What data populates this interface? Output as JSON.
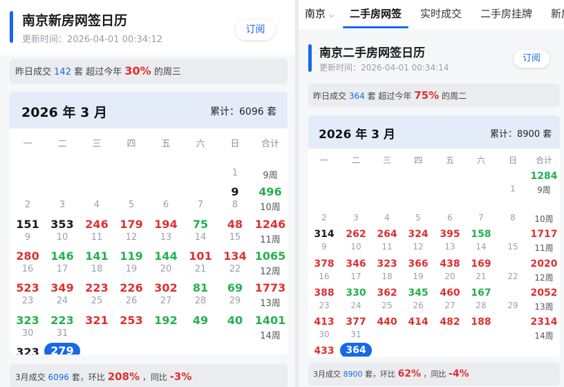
{
  "left": {
    "title": "南京新房网签日历",
    "update_time": "更新时间：2026-04-01 00:34:12",
    "subscribe_label": "订阅",
    "info": {
      "pre": "昨日成交",
      "num": "142",
      "mid": "套 超过今年",
      "pct": "30%",
      "post": "的周三"
    },
    "month": "2026 年 3 月",
    "cumulative": "累计：6096 套",
    "weekday_headers": [
      "一",
      "二",
      "三",
      "四",
      "五",
      "六",
      "日",
      "合计"
    ],
    "weeks": [
      {
        "cells": [
          null,
          null,
          null,
          null,
          null,
          null,
          {
            "day": "1"
          }
        ],
        "sum": null,
        "week": "9周"
      },
      {
        "cells": [
          {
            "day": "2"
          },
          {
            "day": "3"
          },
          {
            "day": "4"
          },
          {
            "day": "5"
          },
          {
            "day": "6"
          },
          {
            "day": "7"
          },
          {
            "val": "9",
            "color": "black",
            "day": "8"
          }
        ],
        "sum": {
          "val": "496",
          "color": "green"
        },
        "week": "10周"
      },
      {
        "cells": [
          {
            "val": "151",
            "color": "black",
            "day": "9"
          },
          {
            "val": "353",
            "color": "black",
            "day": "10"
          },
          {
            "val": "246",
            "color": "red",
            "day": "11"
          },
          {
            "val": "179",
            "color": "red",
            "day": "12"
          },
          {
            "val": "194",
            "color": "red",
            "day": "13"
          },
          {
            "val": "75",
            "color": "green",
            "day": "14"
          },
          {
            "val": "48",
            "color": "red",
            "day": "15"
          }
        ],
        "sum": {
          "val": "1246",
          "color": "red"
        },
        "week": "11周"
      },
      {
        "cells": [
          {
            "val": "280",
            "color": "red",
            "day": "16"
          },
          {
            "val": "146",
            "color": "green",
            "day": "17"
          },
          {
            "val": "141",
            "color": "green",
            "day": "18"
          },
          {
            "val": "119",
            "color": "green",
            "day": "19"
          },
          {
            "val": "144",
            "color": "green",
            "day": "20"
          },
          {
            "val": "101",
            "color": "red",
            "day": "21"
          },
          {
            "val": "134",
            "color": "red",
            "day": "22"
          }
        ],
        "sum": {
          "val": "1065",
          "color": "green"
        },
        "week": "12周"
      },
      {
        "cells": [
          {
            "val": "523",
            "color": "red",
            "day": "23"
          },
          {
            "val": "349",
            "color": "red",
            "day": "24"
          },
          {
            "val": "223",
            "color": "red",
            "day": "25"
          },
          {
            "val": "226",
            "color": "red",
            "day": "26"
          },
          {
            "val": "302",
            "color": "red",
            "day": "27"
          },
          {
            "val": "81",
            "color": "green",
            "day": "28"
          },
          {
            "val": "69",
            "color": "green",
            "day": "29"
          }
        ],
        "sum": {
          "val": "1773",
          "color": "red"
        },
        "week": "13周"
      },
      {
        "cells": [
          {
            "val": "323",
            "color": "green",
            "day": "30"
          },
          {
            "val": "223",
            "color": "green",
            "day": "31"
          },
          {
            "val": "321",
            "color": "red"
          },
          {
            "val": "253",
            "color": "red"
          },
          {
            "val": "192",
            "color": "green"
          },
          {
            "val": "49",
            "color": "green"
          },
          {
            "val": "40",
            "color": "green"
          }
        ],
        "sum": {
          "val": "1401",
          "color": "green"
        },
        "week": "14周"
      },
      {
        "cells": [
          {
            "val": "323",
            "color": "black"
          },
          {
            "today": "279"
          },
          null,
          null,
          null,
          null,
          null
        ],
        "sum": null,
        "week": null
      }
    ],
    "bottom": {
      "pre": "3月成交",
      "num": "6096",
      "mid1": "套，环比",
      "huanbi": "208%",
      "mid2": "，同比",
      "tongbi": "-3%"
    }
  },
  "right": {
    "city": "南京",
    "tabs": [
      "二手房网签",
      "实时成交",
      "二手房挂牌",
      "新房"
    ],
    "title": "南京二手房网签日历",
    "update_time": "更新时间：2026-04-01 00:34:14",
    "subscribe_label": "订阅",
    "info": {
      "pre": "昨日成交",
      "num": "364",
      "mid": "套 超过今年",
      "pct": "75%",
      "post": "的周二"
    },
    "month": "2026 年 3 月",
    "cumulative": "累计：8900 套",
    "weekday_headers": [
      "一",
      "二",
      "三",
      "四",
      "五",
      "六",
      "日",
      "合计"
    ],
    "weeks": [
      {
        "cells": [
          null,
          null,
          null,
          null,
          null,
          null,
          {
            "day": "1"
          }
        ],
        "sum": {
          "val": "1284",
          "color": "green"
        },
        "week": "9周"
      },
      {
        "cells": [
          {
            "day": "2"
          },
          {
            "day": "3"
          },
          {
            "day": "4"
          },
          {
            "day": "5"
          },
          {
            "day": "6"
          },
          {
            "day": "7"
          },
          {
            "day": "8"
          }
        ],
        "sum": null,
        "week": "10周"
      },
      {
        "cells": [
          {
            "val": "314",
            "color": "black",
            "day": "9"
          },
          {
            "val": "262",
            "color": "red",
            "day": "10"
          },
          {
            "val": "264",
            "color": "red",
            "day": "11"
          },
          {
            "val": "324",
            "color": "red",
            "day": "12"
          },
          {
            "val": "395",
            "color": "red",
            "day": "13"
          },
          {
            "val": "158",
            "color": "green",
            "day": "14"
          },
          {
            "day": "15"
          }
        ],
        "sum": {
          "val": "1717",
          "color": "red"
        },
        "week": "11周"
      },
      {
        "cells": [
          {
            "val": "378",
            "color": "red",
            "day": "16"
          },
          {
            "val": "346",
            "color": "red",
            "day": "17"
          },
          {
            "val": "323",
            "color": "red",
            "day": "18"
          },
          {
            "val": "366",
            "color": "red",
            "day": "19"
          },
          {
            "val": "438",
            "color": "red",
            "day": "20"
          },
          {
            "val": "169",
            "color": "red",
            "day": "21"
          },
          {
            "day": "22"
          }
        ],
        "sum": {
          "val": "2020",
          "color": "red"
        },
        "week": "12周"
      },
      {
        "cells": [
          {
            "val": "388",
            "color": "red",
            "day": "23"
          },
          {
            "val": "330",
            "color": "green",
            "day": "24"
          },
          {
            "val": "362",
            "color": "red",
            "day": "25"
          },
          {
            "val": "345",
            "color": "green",
            "day": "26"
          },
          {
            "val": "460",
            "color": "red",
            "day": "27"
          },
          {
            "val": "167",
            "color": "green",
            "day": "28"
          },
          {
            "day": "29"
          }
        ],
        "sum": {
          "val": "2052",
          "color": "red"
        },
        "week": "13周"
      },
      {
        "cells": [
          {
            "val": "413",
            "color": "red",
            "day": "30"
          },
          {
            "val": "377",
            "color": "red",
            "day": "31"
          },
          {
            "val": "440",
            "color": "red"
          },
          {
            "val": "414",
            "color": "red"
          },
          {
            "val": "482",
            "color": "red"
          },
          {
            "val": "188",
            "color": "red"
          },
          null
        ],
        "sum": {
          "val": "2314",
          "color": "red"
        },
        "week": "14周"
      },
      {
        "cells": [
          {
            "val": "433",
            "color": "red"
          },
          {
            "today": "364"
          },
          null,
          null,
          null,
          null,
          null
        ],
        "sum": null,
        "week": null
      }
    ],
    "bottom": {
      "pre": "3月成交",
      "num": "8900",
      "mid1": "套，环比",
      "huanbi": "62%",
      "mid2": "，同比",
      "tongbi": "-4%"
    }
  },
  "colors": {
    "accent": "#1769e8",
    "up": "#e02f2f",
    "down": "#23b14d",
    "header_bg": "#e4ecfa"
  }
}
